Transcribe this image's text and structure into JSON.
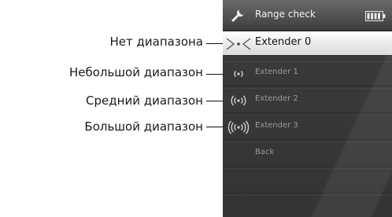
{
  "callouts": [
    {
      "text": "Нет диапазона"
    },
    {
      "text": "Небольшой диапазон"
    },
    {
      "text": "Средний диапазон"
    },
    {
      "text": "Большой диапазон"
    }
  ],
  "screen": {
    "title": "Range check",
    "icons": {
      "title": "wrench-icon",
      "status": "battery-icon"
    },
    "menu": [
      {
        "label": "Extender 0",
        "icon": "no-range-icon",
        "selected": true
      },
      {
        "label": "Extender 1",
        "icon": "small-range-icon",
        "selected": false
      },
      {
        "label": "Extender 2",
        "icon": "medium-range-icon",
        "selected": false
      },
      {
        "label": "Extender 3",
        "icon": "large-range-icon",
        "selected": false
      },
      {
        "label": "Back",
        "icon": "",
        "selected": false
      }
    ]
  }
}
